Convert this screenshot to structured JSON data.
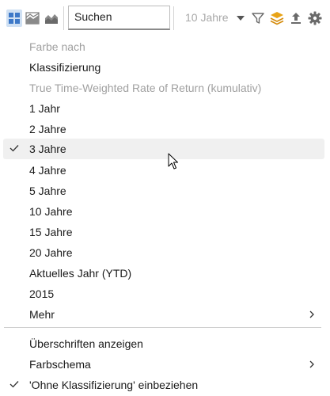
{
  "toolbar": {
    "search_placeholder": "Suchen",
    "period_value": "10 Jahre",
    "icons": [
      "tile-view-icon",
      "area-chart-icon",
      "stacked-area-icon",
      "filter-icon",
      "layers-icon",
      "export-icon",
      "settings-icon"
    ]
  },
  "menu": {
    "items": [
      {
        "label": "Farbe nach",
        "disabled": true
      },
      {
        "label": "Klassifizierung"
      },
      {
        "label": "True Time-Weighted Rate of Return (kumulativ)",
        "disabled": true
      },
      {
        "label": "1 Jahr"
      },
      {
        "label": "2 Jahre"
      },
      {
        "label": "3 Jahre",
        "checked": true,
        "hover": true
      },
      {
        "label": "4 Jahre"
      },
      {
        "label": "5 Jahre"
      },
      {
        "label": "10 Jahre"
      },
      {
        "label": "15 Jahre"
      },
      {
        "label": "20 Jahre"
      },
      {
        "label": "Aktuelles Jahr (YTD)"
      },
      {
        "label": "2015"
      },
      {
        "label": "Mehr",
        "submenu": true
      }
    ],
    "footer_items": [
      {
        "label": "Überschriften anzeigen"
      },
      {
        "label": "Farbschema",
        "submenu": true
      },
      {
        "label": "'Ohne Klassifizierung' einbeziehen",
        "checked": true
      }
    ]
  },
  "colors": {
    "accent_blue": "#3c78c8",
    "layers_orange": "#e8a317",
    "hover_bg": "#f0f0f0",
    "disabled_text": "#a0a0a0"
  }
}
